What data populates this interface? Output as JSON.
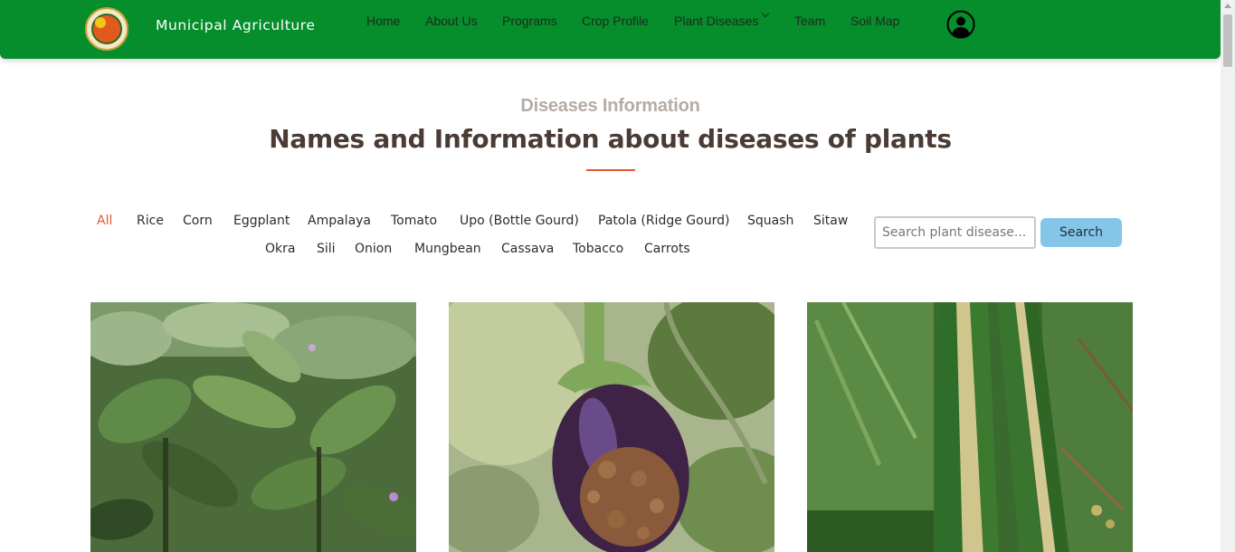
{
  "brand": {
    "name": "Municipal Agriculture",
    "logo_icon": "municipal-seal-icon"
  },
  "nav": {
    "items": [
      {
        "label": "Home"
      },
      {
        "label": "About Us"
      },
      {
        "label": "Programs"
      },
      {
        "label": "Crop Profile"
      },
      {
        "label": "Plant Diseases",
        "has_dropdown": true
      },
      {
        "label": "Team"
      },
      {
        "label": "Soil Map"
      }
    ],
    "account_icon": "user-circle-icon"
  },
  "section": {
    "eyebrow": "Diseases Information",
    "title": "Names and Information about diseases of plants"
  },
  "filters": {
    "active": "All",
    "row1": [
      "All",
      "Rice",
      "Corn",
      "Eggplant",
      "Ampalaya",
      "Tomato",
      "Upo (Bottle Gourd)",
      "Patola (Ridge Gourd)",
      "Squash",
      "Sitaw"
    ],
    "row2": [
      "Okra",
      "Sili",
      "Onion",
      "Mungbean",
      "Cassava",
      "Tobacco",
      "Carrots"
    ]
  },
  "search": {
    "placeholder": "Search plant disease...",
    "button_label": "Search"
  },
  "cards": [
    {
      "image": "wilted eggplant foliage"
    },
    {
      "image": "eggplant fruit with rot spots"
    },
    {
      "image": "striped corn leaves"
    }
  ],
  "colors": {
    "header_green": "#068d2c",
    "accent_orange": "#e4572e",
    "search_button": "#85c6e8",
    "heading_brown": "#4a3b35",
    "eyebrow_gray": "#b5aca6"
  }
}
